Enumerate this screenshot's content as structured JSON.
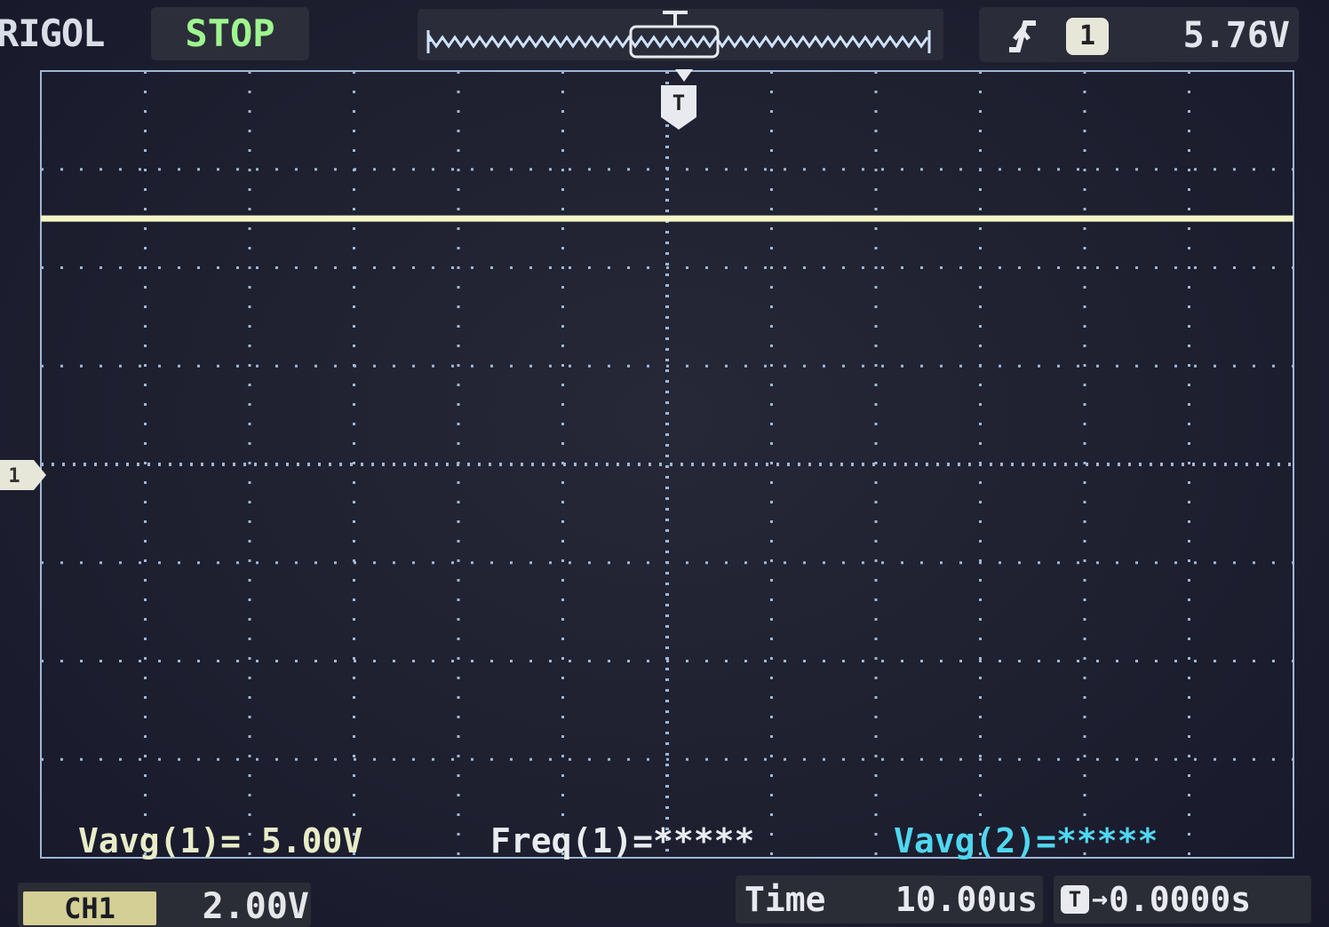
{
  "header": {
    "brand": "RIGOL",
    "run_state": "STOP",
    "trigger_edge_icon": "rising-edge-trigger-icon",
    "trigger_source": "1",
    "trigger_level": "5.76V"
  },
  "channel_marker": {
    "label": "1"
  },
  "waveform_marker": {
    "label": "T"
  },
  "measurements": {
    "vavg1": "Vavg(1)= 5.00V",
    "freq1": "Freq(1)=*****",
    "vavg2": "Vavg(2)=*****"
  },
  "footer": {
    "ch1_label": "CH1",
    "ch1_scale": "2.00V",
    "time_label": "Time",
    "time_value": "10.00us",
    "offset_icon": "T",
    "offset_value": "0.0000s"
  },
  "chart_data": {
    "type": "line",
    "series": [
      {
        "values": [
          5.0,
          5.0
        ]
      }
    ],
    "x": [
      -6e-05,
      6e-05
    ],
    "volts_per_div": 2.0,
    "seconds_per_div": 1e-05,
    "grid": true
  },
  "colors": {
    "trace": "#f4f6c8",
    "grid": "#9fb7d6",
    "ch2_measure": "#4fd7f0",
    "run_state": "#9ff58f"
  }
}
